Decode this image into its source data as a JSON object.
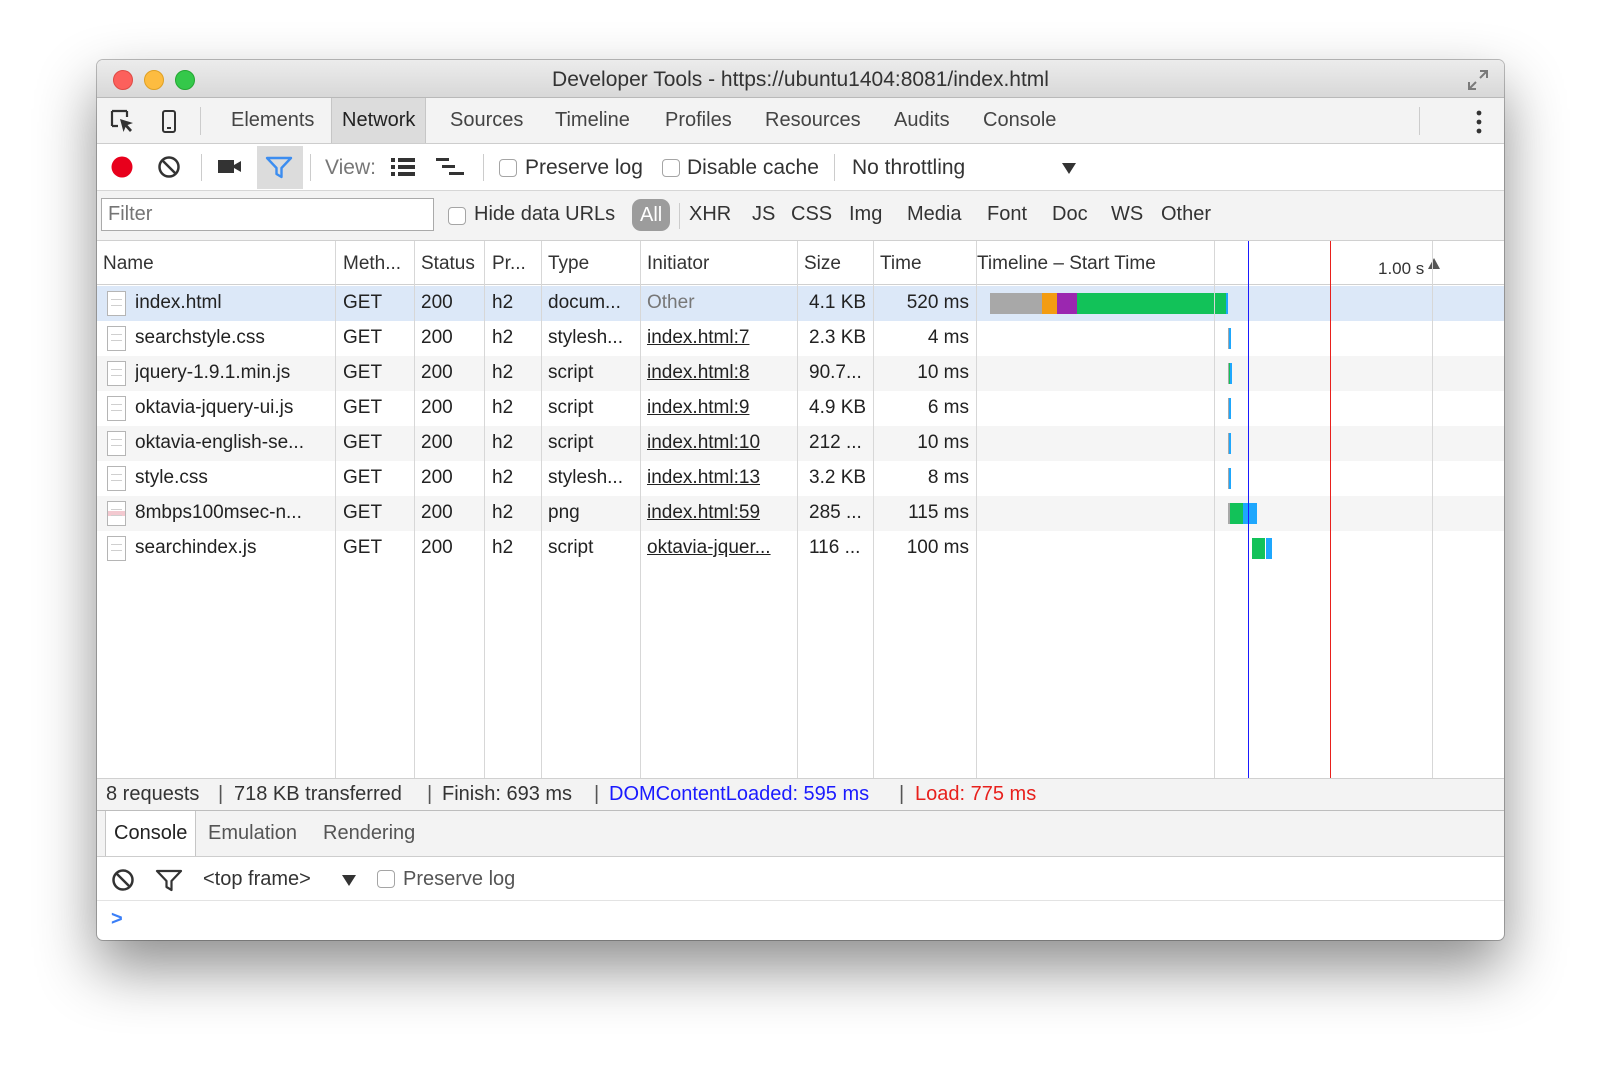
{
  "window": {
    "title": "Developer Tools - https://ubuntu1404:8081/index.html"
  },
  "main_tabs": [
    {
      "label": "Elements",
      "selected": false
    },
    {
      "label": "Network",
      "selected": true
    },
    {
      "label": "Sources",
      "selected": false
    },
    {
      "label": "Timeline",
      "selected": false
    },
    {
      "label": "Profiles",
      "selected": false
    },
    {
      "label": "Resources",
      "selected": false
    },
    {
      "label": "Audits",
      "selected": false
    },
    {
      "label": "Console",
      "selected": false
    }
  ],
  "toolbar": {
    "view_label": "View:",
    "preserve_log_label": "Preserve log",
    "disable_cache_label": "Disable cache",
    "throttling_value": "No throttling",
    "record_color": "#e8001c",
    "filter_color": "#3c8df0"
  },
  "filter_bar": {
    "placeholder": "Filter",
    "hide_data_urls_label": "Hide data URLs",
    "types": [
      "All",
      "XHR",
      "JS",
      "CSS",
      "Img",
      "Media",
      "Font",
      "Doc",
      "WS",
      "Other"
    ],
    "selected_type": "All"
  },
  "table": {
    "columns": [
      "Name",
      "Meth...",
      "Status",
      "Pr...",
      "Type",
      "Initiator",
      "Size",
      "Time",
      "Timeline – Start Time"
    ],
    "timeline_scale_label": "1.00 s",
    "rows": [
      {
        "name": "index.html",
        "method": "GET",
        "status": "200",
        "protocol": "h2",
        "type": "docum...",
        "initiator": "Other",
        "initiator_link": false,
        "size": "4.1 KB",
        "time": "520 ms",
        "icon": "document-icon",
        "timing_ms": [
          {
            "phase": "stalled",
            "start": 28,
            "end": 143,
            "color": "#a8a8a8"
          },
          {
            "phase": "ssl",
            "start": 143,
            "end": 176,
            "color": "#f39c12"
          },
          {
            "phase": "connect",
            "start": 176,
            "end": 219,
            "color": "#9b27b0"
          },
          {
            "phase": "waiting",
            "start": 219,
            "end": 547,
            "color": "#12c259"
          },
          {
            "phase": "download",
            "start": 547,
            "end": 551,
            "color": "#1ea7fd"
          }
        ]
      },
      {
        "name": "searchstyle.css",
        "method": "GET",
        "status": "200",
        "protocol": "h2",
        "type": "stylesh...",
        "initiator": "index.html:7",
        "initiator_link": true,
        "size": "2.3 KB",
        "time": "4 ms",
        "icon": "document-icon",
        "timing_ms": [
          {
            "phase": "stalled",
            "start": 551,
            "end": 553,
            "color": "#a8a8a8"
          },
          {
            "phase": "download",
            "start": 553,
            "end": 557,
            "color": "#1ea7fd"
          }
        ]
      },
      {
        "name": "jquery-1.9.1.min.js",
        "method": "GET",
        "status": "200",
        "protocol": "h2",
        "type": "script",
        "initiator": "index.html:8",
        "initiator_link": true,
        "size": "90.7...",
        "time": "10 ms",
        "icon": "document-icon",
        "timing_ms": [
          {
            "phase": "stalled",
            "start": 551,
            "end": 553,
            "color": "#a8a8a8"
          },
          {
            "phase": "waiting",
            "start": 553,
            "end": 556,
            "color": "#12c259"
          },
          {
            "phase": "download",
            "start": 556,
            "end": 561,
            "color": "#1ea7fd"
          }
        ]
      },
      {
        "name": "oktavia-jquery-ui.js",
        "method": "GET",
        "status": "200",
        "protocol": "h2",
        "type": "script",
        "initiator": "index.html:9",
        "initiator_link": true,
        "size": "4.9 KB",
        "time": "6 ms",
        "icon": "document-icon",
        "timing_ms": [
          {
            "phase": "stalled",
            "start": 551,
            "end": 554,
            "color": "#a8a8a8"
          },
          {
            "phase": "download",
            "start": 554,
            "end": 559,
            "color": "#1ea7fd"
          }
        ]
      },
      {
        "name": "oktavia-english-se...",
        "method": "GET",
        "status": "200",
        "protocol": "h2",
        "type": "script",
        "initiator": "index.html:10",
        "initiator_link": true,
        "size": "212 ...",
        "time": "10 ms",
        "icon": "document-icon",
        "timing_ms": [
          {
            "phase": "stalled",
            "start": 551,
            "end": 554,
            "color": "#a8a8a8"
          },
          {
            "phase": "download",
            "start": 554,
            "end": 559,
            "color": "#1ea7fd"
          }
        ]
      },
      {
        "name": "style.css",
        "method": "GET",
        "status": "200",
        "protocol": "h2",
        "type": "stylesh...",
        "initiator": "index.html:13",
        "initiator_link": true,
        "size": "3.2 KB",
        "time": "8 ms",
        "icon": "document-icon",
        "timing_ms": [
          {
            "phase": "stalled",
            "start": 551,
            "end": 554,
            "color": "#a8a8a8"
          },
          {
            "phase": "download",
            "start": 554,
            "end": 559,
            "color": "#1ea7fd"
          }
        ]
      },
      {
        "name": "8mbps100msec-n...",
        "method": "GET",
        "status": "200",
        "protocol": "h2",
        "type": "png",
        "initiator": "index.html:59",
        "initiator_link": true,
        "size": "285 ...",
        "time": "115 ms",
        "icon": "image-icon",
        "timing_ms": [
          {
            "phase": "stalled",
            "start": 551,
            "end": 557,
            "color": "#a8a8a8"
          },
          {
            "phase": "waiting",
            "start": 557,
            "end": 585,
            "color": "#12c259"
          },
          {
            "phase": "download",
            "start": 585,
            "end": 616,
            "color": "#1ea7fd"
          }
        ]
      },
      {
        "name": "searchindex.js",
        "method": "GET",
        "status": "200",
        "protocol": "h2",
        "type": "script",
        "initiator": "oktavia-jquer...",
        "initiator_link": true,
        "size": "116 ...",
        "time": "100 ms",
        "icon": "document-icon",
        "timing_ms": [
          {
            "phase": "waiting",
            "start": 605,
            "end": 634,
            "color": "#12c259"
          },
          {
            "phase": "download",
            "start": 634,
            "end": 649,
            "color": "#1ea7fd"
          }
        ]
      }
    ],
    "dom_content_loaded_ms": 595,
    "load_ms": 775,
    "timeline_span_ms": 1000
  },
  "summary": {
    "requests": "8 requests",
    "transferred": "718 KB transferred",
    "finish": "Finish: 693 ms",
    "dom_content_loaded": "DOMContentLoaded: 595 ms",
    "load": "Load: 775 ms",
    "dcl_color": "#1a1aff",
    "load_color": "#e8201c"
  },
  "drawer": {
    "tabs": [
      {
        "label": "Console",
        "selected": true
      },
      {
        "label": "Emulation",
        "selected": false
      },
      {
        "label": "Rendering",
        "selected": false
      }
    ],
    "frame_selector": "<top frame>",
    "preserve_log_label": "Preserve log",
    "prompt": ">"
  }
}
